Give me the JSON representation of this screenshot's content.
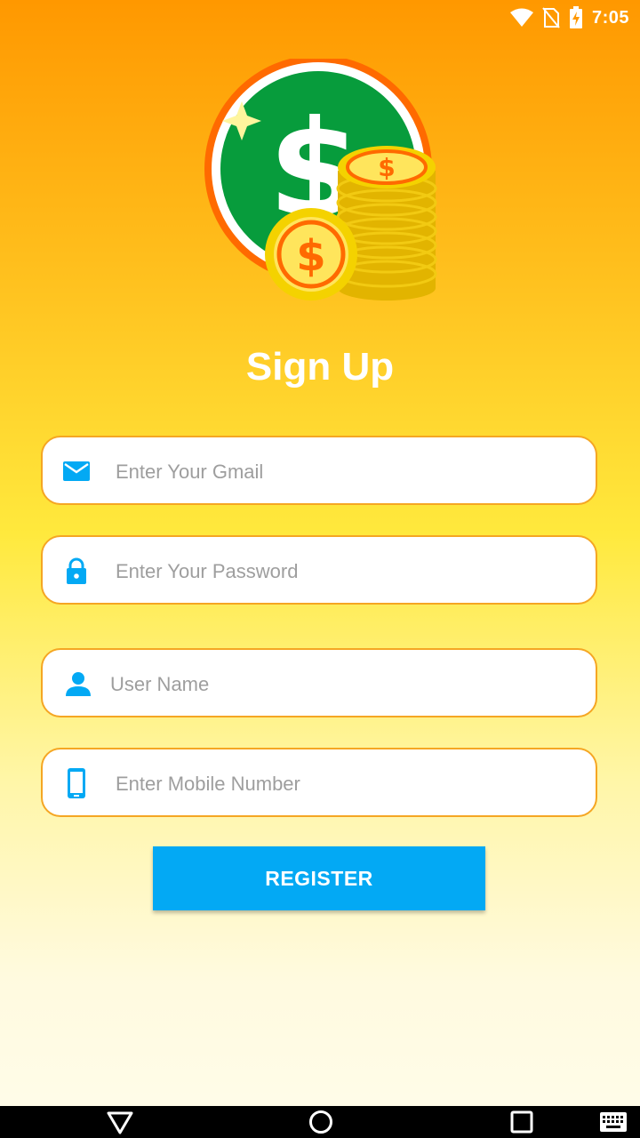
{
  "status_bar": {
    "time": "7:05",
    "icons": [
      "wifi-icon",
      "no-sim-icon",
      "battery-charging-icon"
    ]
  },
  "logo": {
    "icon": "dollar-coins-logo",
    "colors": {
      "ring": "#ff6a00",
      "circle": "#079c3c",
      "coin": "#f4d200",
      "coin_inner": "#ff6a00"
    }
  },
  "page": {
    "title": "Sign Up"
  },
  "form": {
    "fields": [
      {
        "name": "gmail",
        "icon": "mail-icon",
        "placeholder": "Enter Your Gmail",
        "value": ""
      },
      {
        "name": "password",
        "icon": "lock-icon",
        "placeholder": "Enter Your Password",
        "value": ""
      },
      {
        "name": "username",
        "icon": "person-icon",
        "placeholder": "User Name",
        "value": ""
      },
      {
        "name": "mobile",
        "icon": "phone-icon",
        "placeholder": "Enter Mobile Number",
        "value": ""
      }
    ],
    "register_label": "REGISTER"
  },
  "nav_bar": {
    "buttons": [
      "back-icon",
      "home-icon",
      "recents-icon",
      "keyboard-icon"
    ]
  },
  "colors": {
    "accent": "#03a9f4",
    "field_border": "#f5a623",
    "gradient_top": "#ff9800",
    "gradient_bottom": "#fffce8",
    "icon_blue": "#03a9f4"
  }
}
